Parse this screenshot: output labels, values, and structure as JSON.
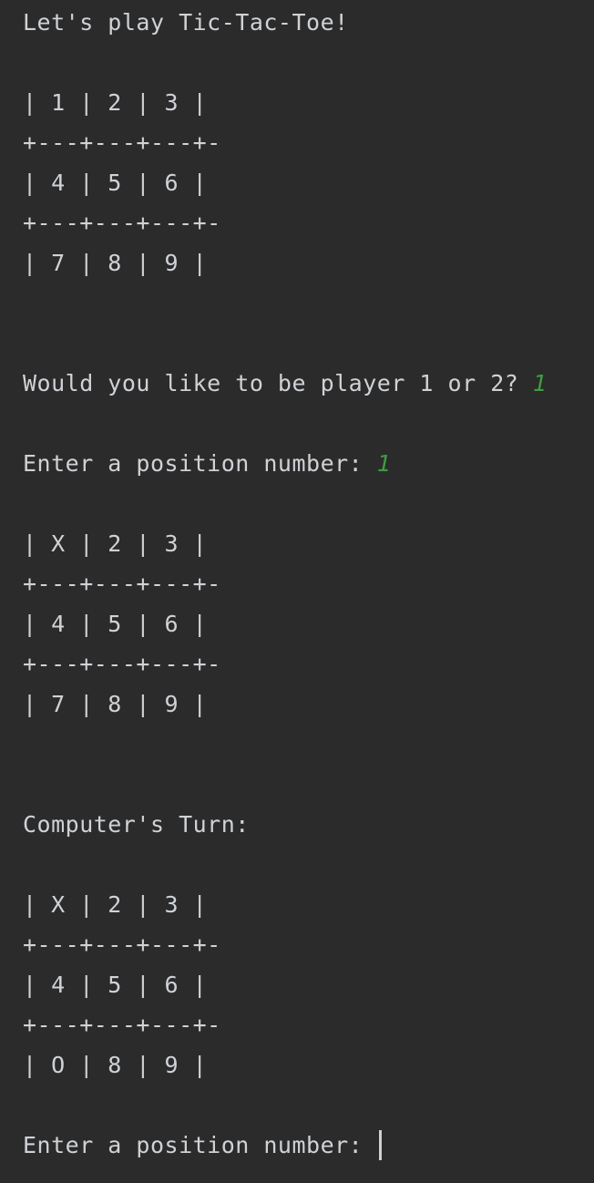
{
  "console": {
    "intro": "Let's play Tic-Tac-Toe!",
    "board1": {
      "row1": "| 1 | 2 | 3 |",
      "sep1": "+---+---+---+-",
      "row2": "| 4 | 5 | 6 |",
      "sep2": "+---+---+---+-",
      "row3": "| 7 | 8 | 9 |"
    },
    "player_prompt": "Would you like to be player 1 or 2? ",
    "player_input": "1",
    "position_prompt1": "Enter a position number: ",
    "position_input1": "1",
    "board2": {
      "row1": "| X | 2 | 3 |",
      "sep1": "+---+---+---+-",
      "row2": "| 4 | 5 | 6 |",
      "sep2": "+---+---+---+-",
      "row3": "| 7 | 8 | 9 |"
    },
    "computer_turn": "Computer's Turn:",
    "board3": {
      "row1": "| X | 2 | 3 |",
      "sep1": "+---+---+---+-",
      "row2": "| 4 | 5 | 6 |",
      "sep2": "+---+---+---+-",
      "row3": "| O | 8 | 9 |"
    },
    "position_prompt2": "Enter a position number: ",
    "colors": {
      "background": "#2b2b2b",
      "text": "#cfd2d6",
      "user_input": "#3f9c3f"
    }
  }
}
